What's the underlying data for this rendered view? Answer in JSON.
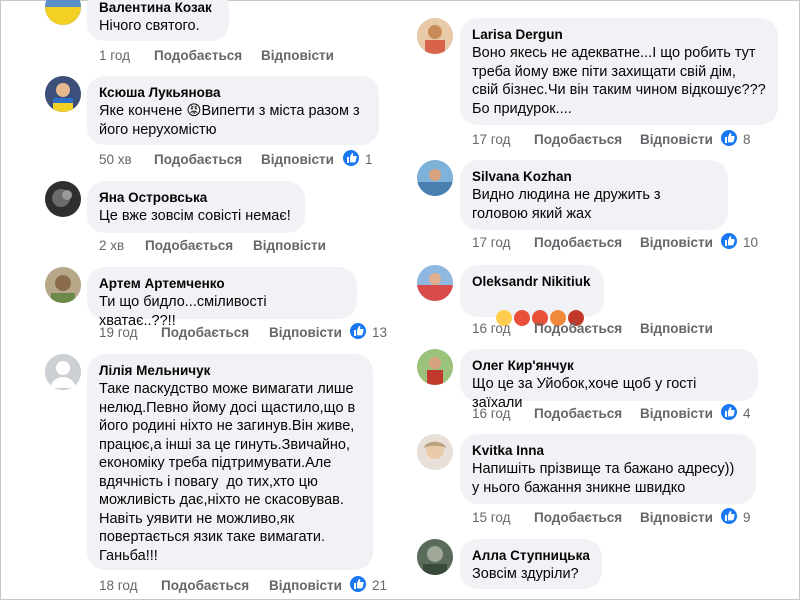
{
  "left": [
    {
      "author": "Валентина Козак",
      "text": "Нічого святого.",
      "time": "1 год",
      "like": "Подобається",
      "reply": "Відповісти",
      "reactions": ""
    },
    {
      "author": "Ксюша Лукьянова",
      "text": "Яке кончене 😡Випerти з міста разом з його нерухомістю",
      "time": "50 хв",
      "like": "Подобається",
      "reply": "Відповісти",
      "reactions": "1"
    },
    {
      "author": "Яна Островська",
      "text": "Це вже зовсім совісті немає!",
      "time": "2 хв",
      "like": "Подобається",
      "reply": "Відповісти",
      "reactions": ""
    },
    {
      "author": "Артем Артемченко",
      "text": "Ти що бидло...сміливості хватає..??!!",
      "time": "19 год",
      "like": "Подобається",
      "reply": "Відповісти",
      "reactions": "13"
    },
    {
      "author": "Лілія Мельничук",
      "text": "Таке паскудство може вимагати лише нелюд.Певно йому досі щастило,що в його родині ніхто не загинув.Він живе, працює,а інші за це гинуть.Звичайно, економіку треба підтримувати.Але вдячність і повагу  до тих,хто цю можливість дає,ніхто не скасовував. Навіть уявити не можливо,як повертається язик таке вимагати. Ганьба!!!",
      "time": "18 год",
      "like": "Подобається",
      "reply": "Відповісти",
      "reactions": "21"
    }
  ],
  "right": [
    {
      "author": "Larisa Dergun",
      "text": "Воно якесь не адекватне...І що робить тут треба йому вже піти захищати свій дім, свій бізнес.Чи він таким чином відкошує???Бо придурок....",
      "time": "17 год",
      "like": "Подобається",
      "reply": "Відповісти",
      "reactions": "8"
    },
    {
      "author": "Silvana Kozhan",
      "text": "Видно людина не дружить з головою який жах",
      "time": "17 год",
      "like": "Подобається",
      "reply": "Відповісти",
      "reactions": "10"
    },
    {
      "author": "Oleksandr Nikitiuk",
      "text": "",
      "time": "16 год",
      "like": "Подобається",
      "reply": "Відповісти",
      "reactions": ""
    },
    {
      "author": "Олег Кир'янчук",
      "text": "Що це за Уйобок,хоче щоб у гості заїхали",
      "time": "16 год",
      "like": "Подобається",
      "reply": "Відповісти",
      "reactions": "4"
    },
    {
      "author": "Kvitka Inna",
      "text": "Напишіть прізвище та бажано адресу))  у нього бажання зникне швидко",
      "time": "15 год",
      "like": "Подобається",
      "reply": "Відповісти",
      "reactions": "9"
    },
    {
      "author": "Алла Ступницька",
      "text": "Зовсім здуріли?",
      "time": "",
      "like": "",
      "reply": "",
      "reactions": ""
    }
  ],
  "emoji_names": [
    "crying-emoji",
    "angry-emoji",
    "angry-emoji",
    "angry-emoji",
    "devil-emoji"
  ],
  "colors": {
    "bubble": "#f0f2f5",
    "meta": "#65676b",
    "like_blue": "#1877f2",
    "text": "#050505"
  }
}
